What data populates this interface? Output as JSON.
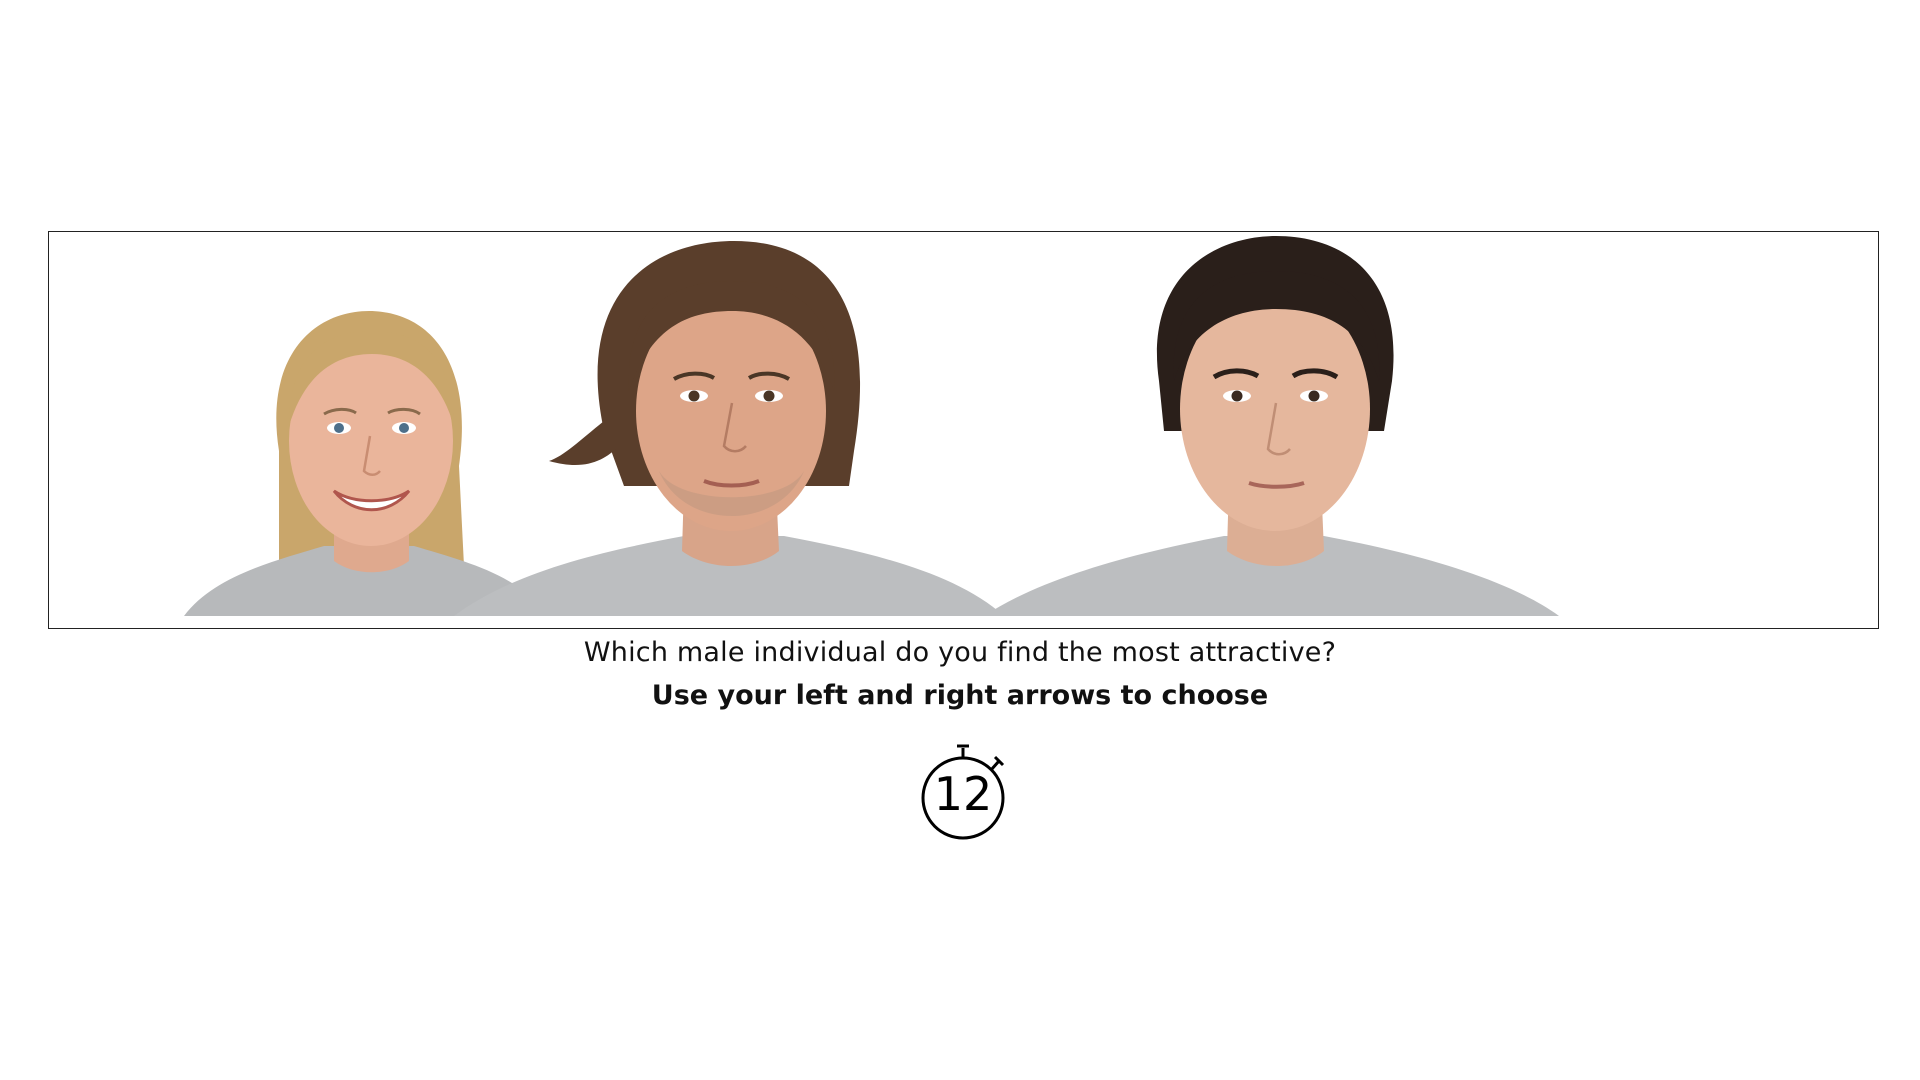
{
  "task": {
    "question": "Which male individual do you find the most attractive?",
    "instruction": "Use your left and right arrows to choose"
  },
  "faces": [
    {
      "role": "distractor",
      "description_icon": "woman-portrait"
    },
    {
      "role": "choice-left",
      "description_icon": "man-portrait"
    },
    {
      "role": "choice-right",
      "description_icon": "man-portrait"
    }
  ],
  "timer": {
    "seconds_remaining": "12",
    "icon": "stopwatch-icon"
  },
  "colors": {
    "background": "#ffffff",
    "panel_border": "#222222",
    "text": "#111111",
    "shirt": "#b7b9bb",
    "skin_light": "#e8b49a",
    "skin_warm": "#d9a184",
    "hair_blonde": "#c9a66b",
    "hair_brown": "#5a3e2b",
    "hair_dark": "#2a1f1a"
  }
}
